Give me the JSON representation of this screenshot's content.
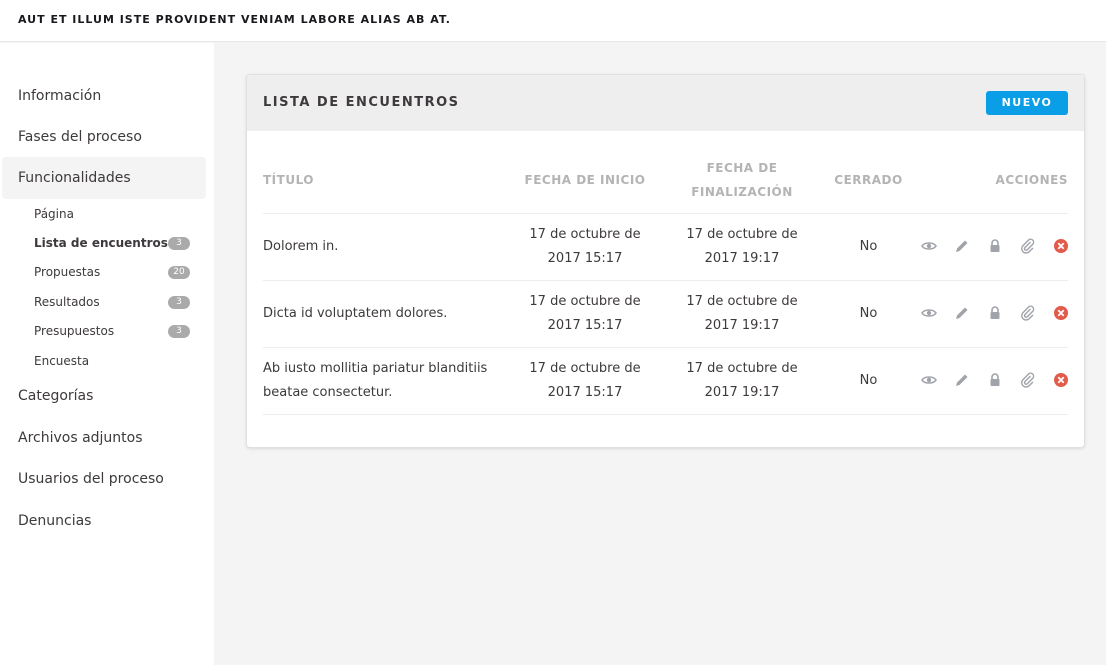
{
  "header": {
    "title": "AUT ET ILLUM ISTE PROVIDENT VENIAM LABORE ALIAS AB AT."
  },
  "sidebar": {
    "items": [
      {
        "label": "Información"
      },
      {
        "label": "Fases del proceso"
      },
      {
        "label": "Funcionalidades"
      },
      {
        "label": "Categorías"
      },
      {
        "label": "Archivos adjuntos"
      },
      {
        "label": "Usuarios del proceso"
      },
      {
        "label": "Denuncias"
      }
    ],
    "subitems": [
      {
        "label": "Página",
        "badge": ""
      },
      {
        "label": "Lista de encuentros",
        "badge": "3"
      },
      {
        "label": "Propuestas",
        "badge": "20"
      },
      {
        "label": "Resultados",
        "badge": "3"
      },
      {
        "label": "Presupuestos",
        "badge": "3"
      },
      {
        "label": "Encuesta",
        "badge": ""
      }
    ]
  },
  "card": {
    "title": "LISTA DE ENCUENTROS",
    "new_button": "NUEVO",
    "columns": {
      "title": "TÍTULO",
      "start": "FECHA DE INICIO",
      "end_line1": "FECHA DE",
      "end_line2": "FINALIZACIÓN",
      "closed": "CERRADO",
      "actions": "ACCIONES"
    },
    "rows": [
      {
        "title": "Dolorem in.",
        "start_date": "17 de octubre de",
        "start_time": "2017 15:17",
        "end_date": "17 de octubre de",
        "end_time": "2017 19:17",
        "closed": "No"
      },
      {
        "title": "Dicta id voluptatem dolores.",
        "start_date": "17 de octubre de",
        "start_time": "2017 15:17",
        "end_date": "17 de octubre de",
        "end_time": "2017 19:17",
        "closed": "No"
      },
      {
        "title_line1": "Ab iusto mollitia pariatur blanditiis",
        "title_line2": "beatae consectetur.",
        "start_date": "17 de octubre de",
        "start_time": "2017 15:17",
        "end_date": "17 de octubre de",
        "end_time": "2017 19:17",
        "closed": "No"
      }
    ]
  },
  "icons": [
    "eye-icon",
    "pencil-icon",
    "lock-icon",
    "paperclip-icon",
    "close-circle-icon"
  ],
  "colors": {
    "accent": "#0a9ee6",
    "danger": "#e25b4b",
    "icon": "#a0a3aa"
  }
}
